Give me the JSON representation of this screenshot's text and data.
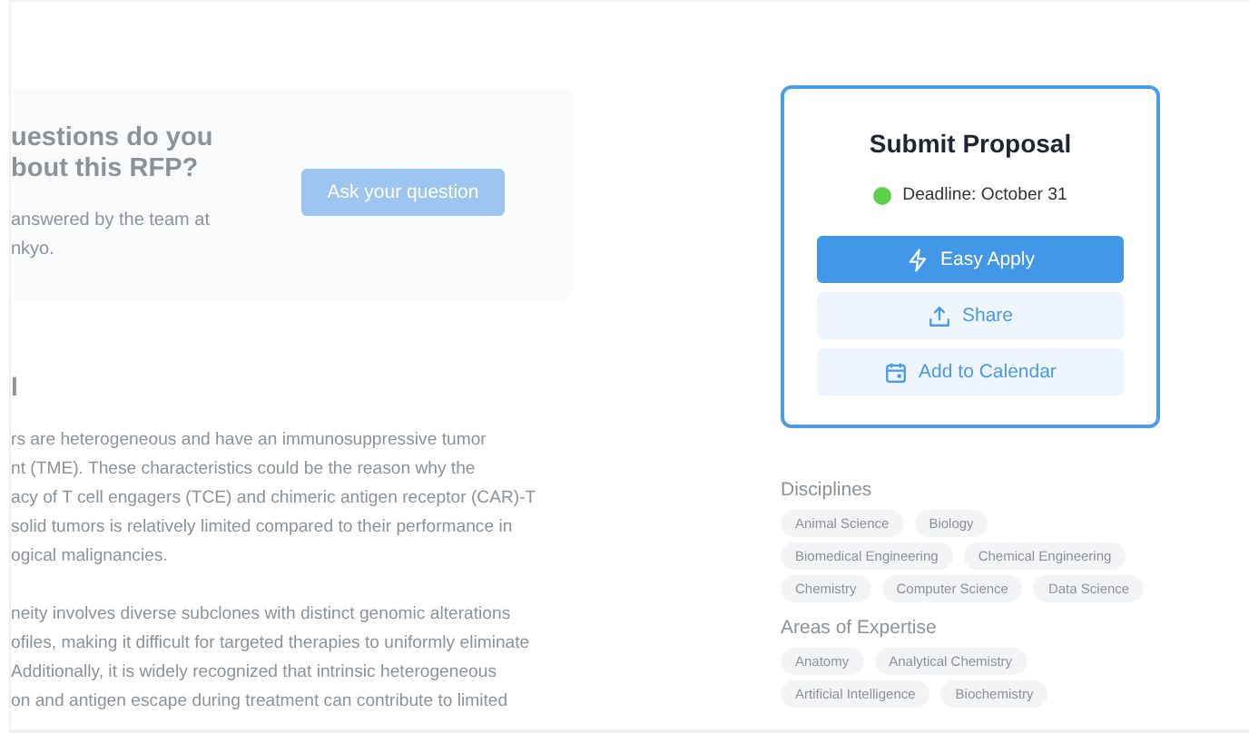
{
  "question_card": {
    "heading_lines": [
      "uestions do you",
      "bout this RFP?"
    ],
    "text_lines": [
      "answered by the team at",
      "nkyo."
    ],
    "button": "Ask your question"
  },
  "section_heading": "l",
  "paragraphs": [
    [
      "rs are heterogeneous and have an immunosuppressive tumor",
      "nt (TME). These characteristics could be the reason why the",
      "acy of T cell engagers (TCE) and chimeric antigen receptor (CAR)-T",
      "solid tumors is relatively limited compared to their performance in",
      "ogical malignancies."
    ],
    [
      "neity involves diverse subclones with distinct genomic alterations",
      "ofiles, making it difficult for targeted therapies to uniformly eliminate",
      "Additionally, it is widely recognized that intrinsic heterogeneous",
      "on and antigen escape during treatment can contribute to limited"
    ]
  ],
  "submit_card": {
    "title": "Submit Proposal",
    "deadline": "Deadline: October 31",
    "buttons": [
      {
        "kind": "primary",
        "label": "Easy Apply"
      },
      {
        "kind": "secondary",
        "label": "Share"
      },
      {
        "kind": "secondary",
        "label": "Add to Calendar"
      }
    ]
  },
  "tag_sections": [
    {
      "title": "Disciplines",
      "tags": [
        "Animal Science",
        "Biology",
        "Biomedical Engineering",
        "Chemical Engineering",
        "Chemistry",
        "Computer Science",
        "Data Science"
      ]
    },
    {
      "title": "Areas of Expertise",
      "tags": [
        "Anatomy",
        "Analytical Chemistry",
        "Artificial Intelligence",
        "Biochemistry"
      ]
    }
  ]
}
